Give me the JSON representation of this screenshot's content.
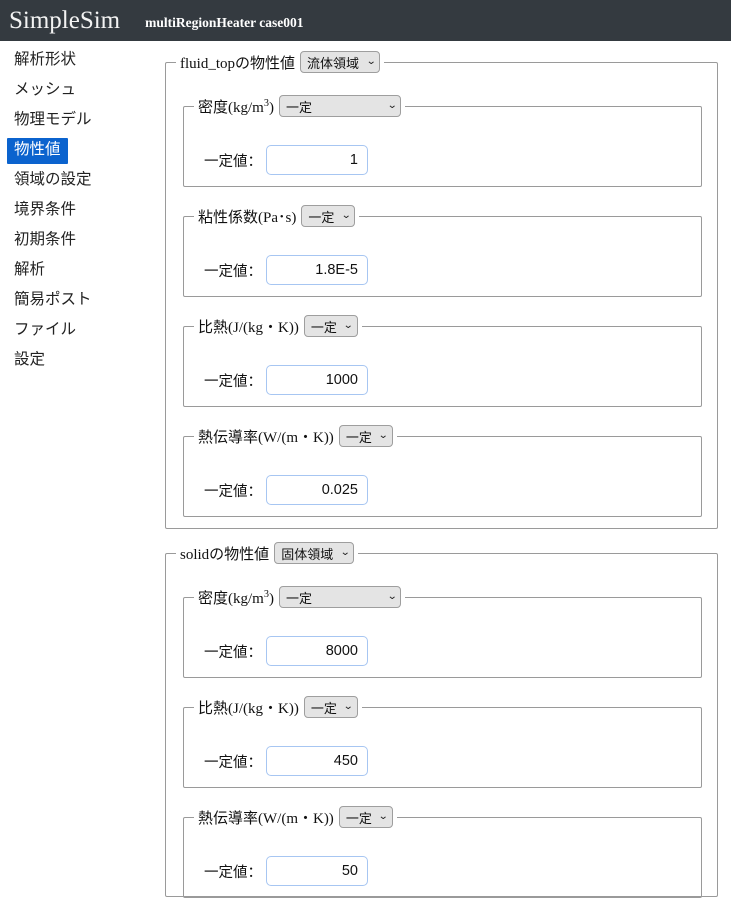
{
  "header": {
    "brand": "SimpleSim",
    "case_title": "multiRegionHeater case001",
    "background_color": "#343a40"
  },
  "sidebar": {
    "selected_index": 3,
    "selected_color": "#0b63ce",
    "items": [
      {
        "label": "解析形状"
      },
      {
        "label": "メッシュ"
      },
      {
        "label": "物理モデル"
      },
      {
        "label": "物性値"
      },
      {
        "label": "領域の設定"
      },
      {
        "label": "境界条件"
      },
      {
        "label": "初期条件"
      },
      {
        "label": "解析"
      },
      {
        "label": "簡易ポスト"
      },
      {
        "label": "ファイル"
      },
      {
        "label": "設定"
      }
    ]
  },
  "main": {
    "regions": [
      {
        "legend": "fluid_topの物性値",
        "region_type": "流体領域",
        "properties": [
          {
            "legend_main": "密度(kg/m",
            "legend_sup": "3",
            "legend_tail": ")",
            "mode": "一定",
            "mode_width": "wide",
            "value_label": "一定値：",
            "value": "1"
          },
          {
            "legend_main": "粘性係数(Pa･s)",
            "legend_sup": "",
            "legend_tail": "",
            "mode": "一定",
            "mode_width": "narrow",
            "value_label": "一定値：",
            "value": "1.8E-5"
          },
          {
            "legend_main": "比熱(J/(kg・K))",
            "legend_sup": "",
            "legend_tail": "",
            "mode": "一定",
            "mode_width": "narrow",
            "value_label": "一定値：",
            "value": "1000"
          },
          {
            "legend_main": "熱伝導率(W/(m・K))",
            "legend_sup": "",
            "legend_tail": "",
            "mode": "一定",
            "mode_width": "narrow",
            "value_label": "一定値：",
            "value": "0.025"
          }
        ]
      },
      {
        "legend": "solidの物性値",
        "region_type": "固体領域",
        "properties": [
          {
            "legend_main": "密度(kg/m",
            "legend_sup": "3",
            "legend_tail": ")",
            "mode": "一定",
            "mode_width": "wide",
            "value_label": "一定値：",
            "value": "8000"
          },
          {
            "legend_main": "比熱(J/(kg・K))",
            "legend_sup": "",
            "legend_tail": "",
            "mode": "一定",
            "mode_width": "narrow",
            "value_label": "一定値：",
            "value": "450"
          },
          {
            "legend_main": "熱伝導率(W/(m・K))",
            "legend_sup": "",
            "legend_tail": "",
            "mode": "一定",
            "mode_width": "narrow",
            "value_label": "一定値：",
            "value": "50"
          }
        ]
      }
    ],
    "chevron_glyph": "⌄"
  }
}
